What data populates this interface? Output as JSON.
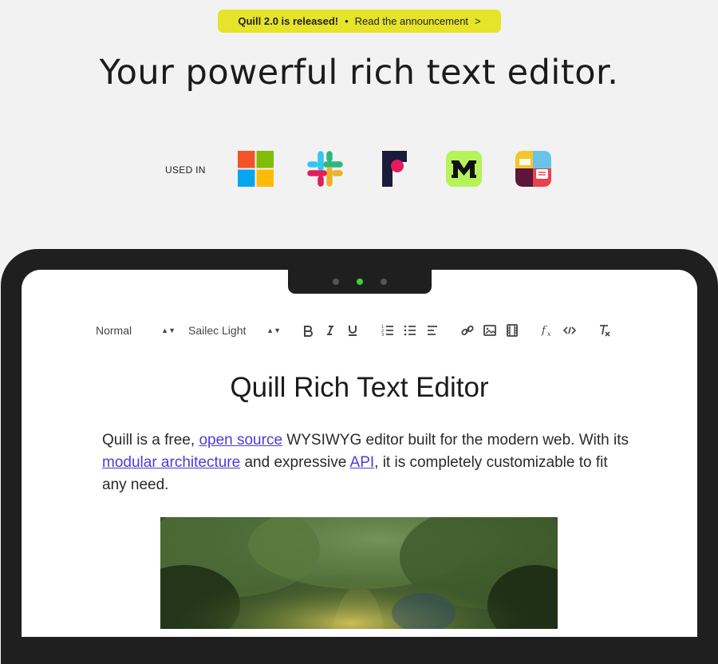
{
  "banner": {
    "strong": "Quill 2.0 is released!",
    "bullet": "•",
    "link": "Read the announcement",
    "chevron": ">"
  },
  "headline": "Your powerful rich text editor.",
  "used_in": {
    "label": "USED IN",
    "logos": [
      "microsoft-logo",
      "slack-logo",
      "figma-logo",
      "miro-logo",
      "salesforce-quip-logo"
    ]
  },
  "carousel": {
    "dots": 3,
    "active_index": 1
  },
  "toolbar": {
    "header_select": "Normal",
    "font_select": "Sailec Light",
    "buttons": [
      "bold-icon",
      "italic-icon",
      "underline-icon",
      "ordered-list-icon",
      "bullet-list-icon",
      "align-icon",
      "link-icon",
      "image-icon",
      "video-icon",
      "formula-icon",
      "code-icon",
      "clean-icon"
    ]
  },
  "editor": {
    "title": "Quill Rich Text Editor",
    "p1_a": "Quill is a free, ",
    "link_open_source": "open source",
    "p1_b": " WYSIWYG editor built for the modern web. With its ",
    "link_modular": "modular architecture",
    "p1_c": " and expressive ",
    "link_api": "API",
    "p1_d": ", it is completely customizable to fit any need."
  },
  "colors": {
    "banner": "#e5e32a",
    "link": "#4c3cd9",
    "active_dot": "#39d23a",
    "device": "#1f1f1f"
  }
}
